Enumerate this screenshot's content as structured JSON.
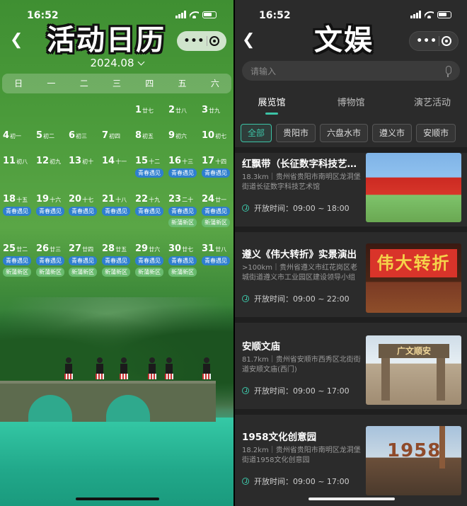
{
  "status": {
    "time": "16:52"
  },
  "left": {
    "title": "活动日历",
    "month": "2024.08",
    "weekdays": [
      "日",
      "一",
      "二",
      "三",
      "四",
      "五",
      "六"
    ],
    "tags": {
      "q": "青春遇见",
      "x": "新蒲新区"
    },
    "days": [
      {
        "d": "1",
        "l": "廿七"
      },
      {
        "d": "2",
        "l": "廿八"
      },
      {
        "d": "3",
        "l": "廿九"
      },
      {
        "d": "4",
        "l": "初一"
      },
      {
        "d": "5",
        "l": "初二"
      },
      {
        "d": "6",
        "l": "初三"
      },
      {
        "d": "7",
        "l": "初四"
      },
      {
        "d": "8",
        "l": "初五"
      },
      {
        "d": "9",
        "l": "初六"
      },
      {
        "d": "10",
        "l": "初七"
      },
      {
        "d": "11",
        "l": "初八"
      },
      {
        "d": "12",
        "l": "初九"
      },
      {
        "d": "13",
        "l": "初十"
      },
      {
        "d": "14",
        "l": "十一"
      },
      {
        "d": "15",
        "l": "十二"
      },
      {
        "d": "16",
        "l": "十三"
      },
      {
        "d": "17",
        "l": "十四"
      },
      {
        "d": "18",
        "l": "十五"
      },
      {
        "d": "19",
        "l": "十六"
      },
      {
        "d": "20",
        "l": "十七"
      },
      {
        "d": "21",
        "l": "十八"
      },
      {
        "d": "22",
        "l": "十九"
      },
      {
        "d": "23",
        "l": "二十"
      },
      {
        "d": "24",
        "l": "廿一"
      },
      {
        "d": "25",
        "l": "廿二"
      },
      {
        "d": "26",
        "l": "廿三"
      },
      {
        "d": "27",
        "l": "廿四"
      },
      {
        "d": "28",
        "l": "廿五"
      },
      {
        "d": "29",
        "l": "廿六"
      },
      {
        "d": "30",
        "l": "廿七"
      },
      {
        "d": "31",
        "l": "廿八"
      }
    ]
  },
  "right": {
    "title": "文娱",
    "search_placeholder": "请输入",
    "tabs": [
      "展览馆",
      "博物馆",
      "演艺活动"
    ],
    "active_tab": "展览馆",
    "chips": [
      "全部",
      "贵阳市",
      "六盘水市",
      "遵义市",
      "安顺市"
    ],
    "cards": [
      {
        "title": "红飘带（长征数字科技艺术馆）",
        "addr": "18.3km｜贵州省贵阳市南明区龙洞堡街道长征数字科技艺术馆",
        "open": "开放时间：09:00 ~ 18:00"
      },
      {
        "title": "遵义《伟大转折》实景演出",
        "addr": ">100km｜贵州省遵义市红花岗区老城街道遵义市工业园区建设领导小组",
        "open": "开放时间：09:00 ~ 22:00",
        "banner": "伟大转折"
      },
      {
        "title": "安顺文庙",
        "addr": "81.7km｜贵州省安顺市西秀区北街街道安顺文庙(西门)",
        "open": "开放时间：09:00 ~ 17:00",
        "gate": "广文顺安"
      },
      {
        "title": "1958文化创意园",
        "addr": "18.2km｜贵州省贵阳市南明区龙洞堡街道1958文化创意园",
        "open": "开放时间：09:00 ~ 17:00",
        "sign": "1958"
      }
    ]
  }
}
